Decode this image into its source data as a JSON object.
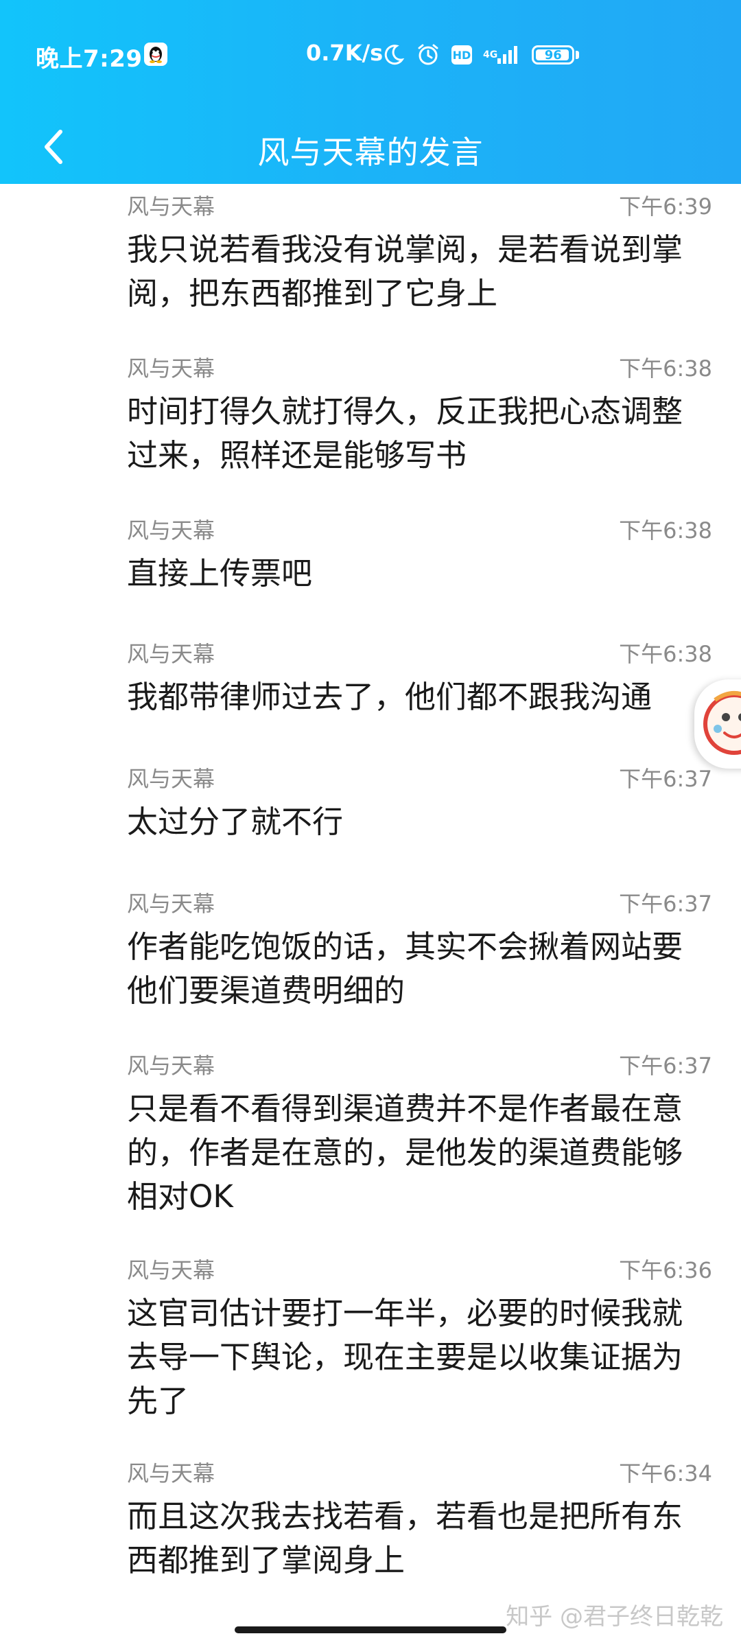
{
  "status_bar": {
    "time": "晚上7:29",
    "net_speed": "0.7K/s",
    "hd_label": "HD",
    "network_type": "4G",
    "battery": "96",
    "battery_level": 0.96
  },
  "header": {
    "title": "风与天幕的发言"
  },
  "messages": [
    {
      "author": "风与天幕",
      "time": "下午6:39",
      "text": "我只说若看我没有说掌阅，是若看说到掌阅，把东西都推到了它身上"
    },
    {
      "author": "风与天幕",
      "time": "下午6:38",
      "text": "时间打得久就打得久，反正我把心态调整过来，照样还是能够写书"
    },
    {
      "author": "风与天幕",
      "time": "下午6:38",
      "text": "直接上传票吧"
    },
    {
      "author": "风与天幕",
      "time": "下午6:38",
      "text": "我都带律师过去了，他们都不跟我沟通"
    },
    {
      "author": "风与天幕",
      "time": "下午6:37",
      "text": "太过分了就不行"
    },
    {
      "author": "风与天幕",
      "time": "下午6:37",
      "text": "作者能吃饱饭的话，其实不会揪着网站要他们要渠道费明细的"
    },
    {
      "author": "风与天幕",
      "time": "下午6:37",
      "text": "只是看不看得到渠道费并不是作者最在意的，作者是在意的，是他发的渠道费能够相对OK"
    },
    {
      "author": "风与天幕",
      "time": "下午6:36",
      "text": "这官司估计要打一年半，必要的时候我就去导一下舆论，现在主要是以收集证据为先了"
    },
    {
      "author": "风与天幕",
      "time": "下午6:34",
      "text": "而且这次我去找若看，若看也是把所有东西都推到了掌阅身上"
    }
  ],
  "watermark": "知乎 @君子终日乾乾"
}
